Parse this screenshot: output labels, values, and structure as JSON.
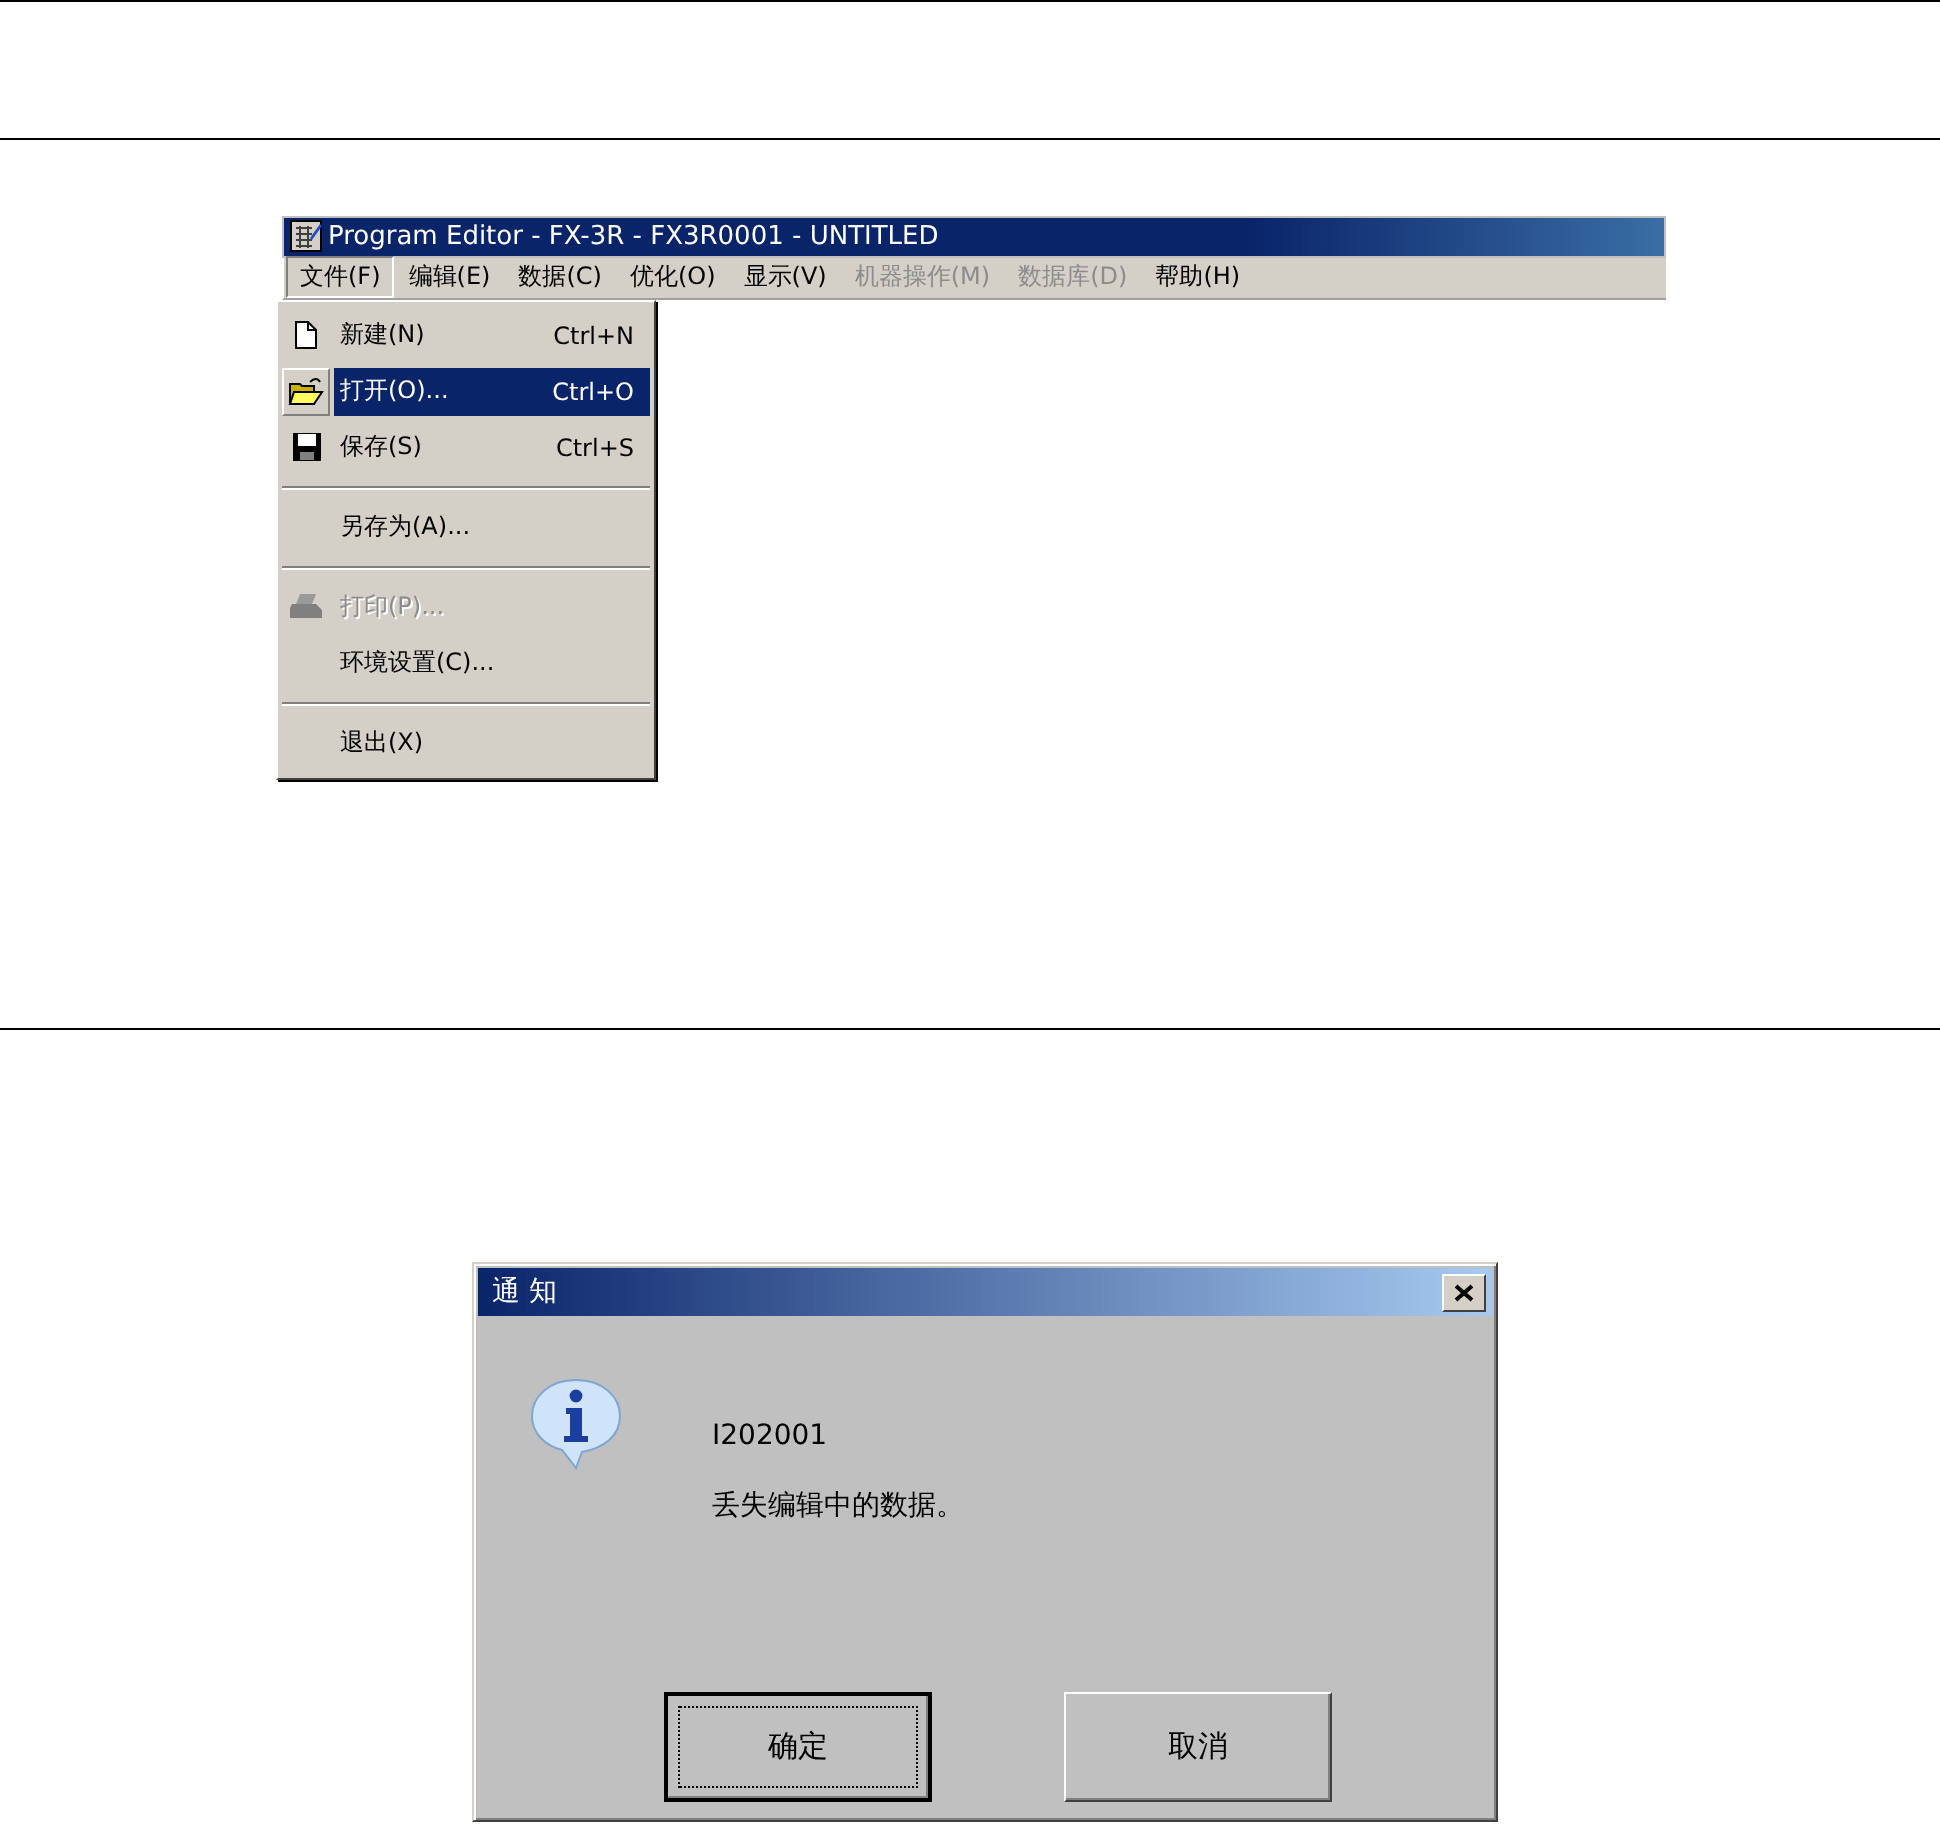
{
  "editor_window": {
    "title": "Program Editor - FX-3R - FX3R0001 - UNTITLED",
    "menu_bar": [
      {
        "label": "文件(F)",
        "selected": true,
        "disabled": false
      },
      {
        "label": "编辑(E)",
        "selected": false,
        "disabled": false
      },
      {
        "label": "数据(C)",
        "selected": false,
        "disabled": false
      },
      {
        "label": "优化(O)",
        "selected": false,
        "disabled": false
      },
      {
        "label": "显示(V)",
        "selected": false,
        "disabled": false
      },
      {
        "label": "机器操作(M)",
        "selected": false,
        "disabled": true
      },
      {
        "label": "数据库(D)",
        "selected": false,
        "disabled": true
      },
      {
        "label": "帮助(H)",
        "selected": false,
        "disabled": false
      }
    ],
    "file_menu": [
      {
        "kind": "item",
        "label": "新建(N)",
        "shortcut": "Ctrl+N",
        "selected": false,
        "disabled": false
      },
      {
        "kind": "item",
        "label": "打开(O)...",
        "shortcut": "Ctrl+O",
        "selected": true,
        "disabled": false
      },
      {
        "kind": "item",
        "label": "保存(S)",
        "shortcut": "Ctrl+S",
        "selected": false,
        "disabled": false
      },
      {
        "kind": "separator"
      },
      {
        "kind": "item",
        "label": "另存为(A)...",
        "selected": false,
        "disabled": false
      },
      {
        "kind": "separator"
      },
      {
        "kind": "item",
        "label": "打印(P)...",
        "selected": false,
        "disabled": true
      },
      {
        "kind": "item",
        "label": "环境设置(C)...",
        "selected": false,
        "disabled": false
      },
      {
        "kind": "separator"
      },
      {
        "kind": "item",
        "label": "退出(X)",
        "selected": false,
        "disabled": false
      }
    ]
  },
  "dialog": {
    "title": "通 知",
    "code": "I202001",
    "message": "丢失编辑中的数据。",
    "buttons": [
      {
        "label": "确定",
        "default": true
      },
      {
        "label": "取消",
        "default": false
      }
    ]
  }
}
